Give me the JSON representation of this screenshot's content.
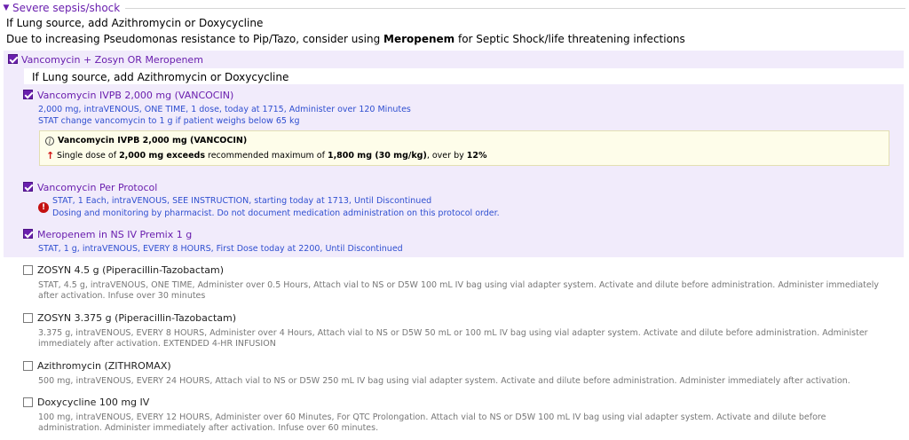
{
  "section": {
    "title": "Severe sepsis/shock"
  },
  "notes": {
    "line1": "If Lung source, add Azithromycin or Doxycycline",
    "line2_pre": "Due to increasing Pseudomonas resistance to Pip/Tazo, consider using ",
    "line2_bold": "Meropenem",
    "line2_post": " for Septic Shock/life threatening infections"
  },
  "group": {
    "label": "Vancomycin + Zosyn OR Meropenem",
    "note": "If Lung source, add Azithromycin or Doxycycline",
    "checked": true
  },
  "orders": [
    {
      "title": "Vancomycin IVPB 2,000 mg (VANCOCIN)",
      "detail1": "2,000 mg, intraVENOUS, ONE TIME, 1 dose, today at 1715, Administer over 120 Minutes",
      "detail2": "STAT change vancomycin to 1 g if patient weighs below 65 kg",
      "checked": true
    },
    {
      "title": "Vancomycin Per Protocol",
      "detail1": "STAT, 1 Each, intraVENOUS, SEE INSTRUCTION, starting today at 1713, Until Discontinued",
      "detail2": "Dosing and monitoring by pharmacist. Do not document medication administration on this protocol order.",
      "checked": true
    },
    {
      "title": "Meropenem in NS IV Premix 1 g",
      "detail1": "STAT, 1 g, intraVENOUS, EVERY 8 HOURS, First Dose today at 2200, Until Discontinued",
      "checked": true
    },
    {
      "title": "ZOSYN 4.5 g (Piperacillin-Tazobactam)",
      "detail1": "STAT, 4.5 g, intraVENOUS, ONE TIME, Administer over 0.5 Hours, Attach vial to NS or D5W 100 mL IV bag using vial adapter system.  Activate and dilute before administration.  Administer immediately after activation. Infuse over 30 minutes",
      "checked": false
    },
    {
      "title": "ZOSYN 3.375 g (Piperacillin-Tazobactam)",
      "detail1": "3.375 g, intraVENOUS, EVERY 8 HOURS, Administer over 4 Hours, Attach vial to NS or D5W 50 mL or 100 mL IV bag using vial adapter system.  Activate and dilute before administration.  Administer immediately after activation. EXTENDED 4-HR INFUSION",
      "checked": false
    },
    {
      "title": "Azithromycin  (ZITHROMAX)",
      "detail1": "500 mg, intraVENOUS, EVERY 24 HOURS, Attach vial to NS or D5W 250 mL IV bag using vial adapter system.  Activate and dilute before administration.  Administer immediately after activation.",
      "checked": false
    },
    {
      "title": "Doxycycline 100 mg IV",
      "detail1": "100 mg, intraVENOUS, EVERY 12 HOURS, Administer over 60 Minutes, For QTC Prolongation. Attach vial to NS or D5W 100 mL IV bag using vial adapter system.  Activate and dilute before administration.  Administer immediately after activation. Infuse over 60 minutes.",
      "checked": false
    }
  ],
  "alert": {
    "title": "Vancomycin IVPB 2,000 mg (VANCOCIN)",
    "msg_pre": "Single dose of ",
    "msg_bold1": "2,000 mg exceeds",
    "msg_mid": " recommended maximum of ",
    "msg_bold2": "1,800 mg (30 mg/kg)",
    "msg_mid2": ", over by ",
    "msg_bold3": "12%"
  },
  "colors": {
    "accent": "#6a1fae",
    "detail_blue": "#2f4fd0",
    "group_bg": "#f1ebfb",
    "alert_bg": "#fefdea",
    "error_red": "#c41010"
  }
}
